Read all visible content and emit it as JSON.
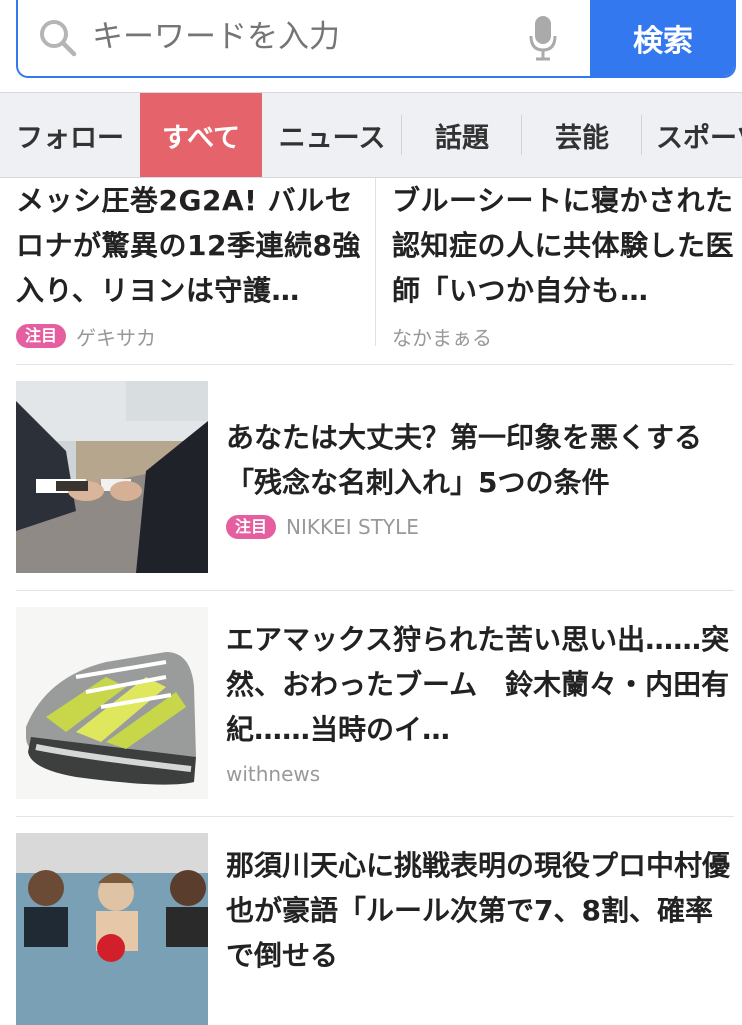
{
  "search": {
    "placeholder": "キーワードを入力",
    "button_label": "検索"
  },
  "tabs": [
    {
      "label": "フォロー",
      "active": false
    },
    {
      "label": "すべて",
      "active": true
    },
    {
      "label": "ニュース",
      "active": false
    },
    {
      "label": "話題",
      "active": false
    },
    {
      "label": "芸能",
      "active": false
    },
    {
      "label": "スポーツ",
      "active": false
    }
  ],
  "top_articles": [
    {
      "title": "メッシ圧巻2G2A! バルセロナが驚異の12季連続8強入り、リヨンは守護…",
      "badge": "注目",
      "source": "ゲキサカ"
    },
    {
      "title": "ブルーシートに寝かされた認知症の人に共体験した医師「いつか自分も…",
      "badge": "",
      "source": "なかまぁる"
    }
  ],
  "articles": [
    {
      "title": "あなたは大丈夫？第一印象を悪くする「残念な名刺入れ」5つの条件",
      "badge": "注目",
      "source": "NIKKEI STYLE",
      "thumbnail": "business-card-exchange-photo"
    },
    {
      "title": "エアマックス狩られた苦い思い出……突然、おわったブーム　鈴木蘭々・内田有紀……当時のイ…",
      "badge": "",
      "source": "withnews",
      "thumbnail": "sneaker-photo"
    },
    {
      "title": "那須川天心に挑戦表明の現役プロ中村優也が豪語「ルール次第で7、8割、確率で倒せる",
      "badge": "",
      "source": "",
      "thumbnail": "boxers-photo"
    }
  ],
  "colors": {
    "accent_blue": "#3478f0",
    "active_tab": "#e5646b",
    "badge_pink": "#e55fa0"
  }
}
